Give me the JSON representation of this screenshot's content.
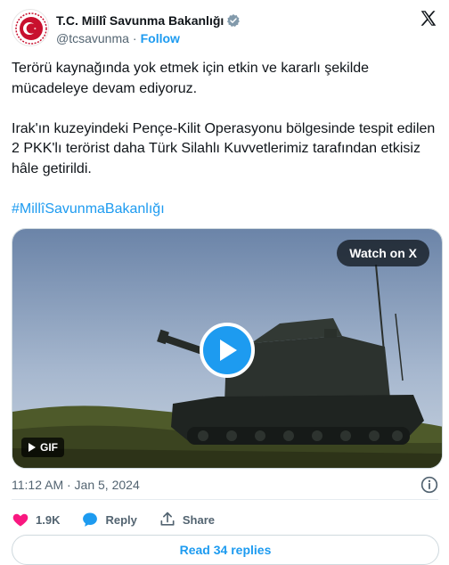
{
  "account": {
    "name": "T.C. Millî Savunma Bakanlığı",
    "handle": "@tcsavunma",
    "separator": "·",
    "follow_label": "Follow"
  },
  "tweet": {
    "paragraph1": "Terörü kaynağında yok etmek için etkin ve kararlı şekilde mücadeleye devam ediyoruz.",
    "paragraph2": "Irak'ın kuzeyindeki Pençe-Kilit Operasyonu bölgesinde tespit edilen 2 PKK'lı terörist daha Türk Silahlı Kuvvetlerimiz tarafından etkisiz hâle getirildi.",
    "hashtag": "#MillîSavunmaBakanlığı"
  },
  "media": {
    "watch_label": "Watch on X",
    "gif_label": "GIF"
  },
  "meta": {
    "timestamp": "11:12 AM · Jan 5, 2024"
  },
  "actions": {
    "like_count": "1.9K",
    "reply_label": "Reply",
    "share_label": "Share"
  },
  "replies_label": "Read 34 replies",
  "colors": {
    "accent": "#1d9bf0",
    "like": "#f91880",
    "text": "#0f1419",
    "muted": "#536471"
  },
  "icons": [
    "ministry-seal-avatar",
    "verified-badge-icon",
    "x-logo-icon",
    "play-icon",
    "info-icon",
    "heart-icon",
    "reply-bubble-icon",
    "share-icon",
    "gif-icon"
  ]
}
